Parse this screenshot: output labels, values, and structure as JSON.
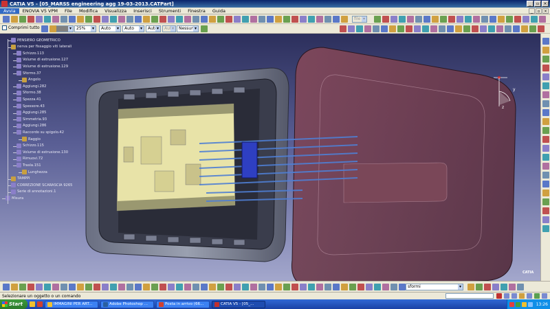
{
  "window": {
    "title": "CATIA V5 - [05_MARSS engineering agg 19-03-2013.CATPart]"
  },
  "menubar": {
    "items": [
      "Avvia",
      "ENOVIA V5 VPM",
      "File",
      "Modifica",
      "Visualizza",
      "Inserisci",
      "Strumenti",
      "Finestra",
      "Guida"
    ]
  },
  "toolbar": {
    "comprimi_label": "Comprimi tutto",
    "zoom_value": "25%",
    "combo_auto_1": "Auto",
    "combo_auto_2": "Auto",
    "combo_auto_3": "Auto",
    "combo_auto_4": "Auto",
    "combo_nessuno": "Nessuno",
    "combo_file": "file"
  },
  "spec_tree": {
    "nodes": [
      {
        "label": "PENSIERO GEOMETRICO",
        "level": 1,
        "icon_color": "#8a7fc9"
      },
      {
        "label": "nerva per fissaggio viti laterali",
        "level": 1,
        "icon_color": "#c8a040"
      },
      {
        "label": "Schizzo.113",
        "level": 2,
        "icon_color": "#8a7fc9"
      },
      {
        "label": "Volume di estrusione.127",
        "level": 2,
        "icon_color": "#8a7fc9"
      },
      {
        "label": "Volume di estrusione.129",
        "level": 2,
        "icon_color": "#8a7fc9"
      },
      {
        "label": "Sformo.37",
        "level": 2,
        "icon_color": "#8a7fc9"
      },
      {
        "label": "Angolo",
        "level": 3,
        "icon_color": "#c8a040"
      },
      {
        "label": "Aggiungi.282",
        "level": 2,
        "icon_color": "#8a7fc9"
      },
      {
        "label": "Sformo.38",
        "level": 2,
        "icon_color": "#8a7fc9"
      },
      {
        "label": "Spezza.41",
        "level": 2,
        "icon_color": "#8a7fc9"
      },
      {
        "label": "Spessore.43",
        "level": 2,
        "icon_color": "#8a7fc9"
      },
      {
        "label": "Aggiungi.285",
        "level": 2,
        "icon_color": "#8a7fc9"
      },
      {
        "label": "Simmetria.93",
        "level": 2,
        "icon_color": "#8a7fc9"
      },
      {
        "label": "Aggiungi.286",
        "level": 2,
        "icon_color": "#8a7fc9"
      },
      {
        "label": "Raccordo su spigolo.42",
        "level": 2,
        "icon_color": "#8a7fc9"
      },
      {
        "label": "Raggio",
        "level": 3,
        "icon_color": "#c8a040"
      },
      {
        "label": "Schizzo.115",
        "level": 2,
        "icon_color": "#8a7fc9"
      },
      {
        "label": "Volume di estrusione.130",
        "level": 2,
        "icon_color": "#8a7fc9"
      },
      {
        "label": "Rimuovi.72",
        "level": 2,
        "icon_color": "#8a7fc9"
      },
      {
        "label": "Trasla.151",
        "level": 2,
        "icon_color": "#8a7fc9"
      },
      {
        "label": "Lunghezza",
        "level": 3,
        "icon_color": "#c8a040"
      },
      {
        "label": "TAMPPI",
        "level": 1,
        "icon_color": "#c8a040"
      },
      {
        "label": "CORREZIONE SCARASCIA 9265",
        "level": 1,
        "icon_color": "#8a7fc9"
      },
      {
        "label": "Serie di annotazioni.1",
        "level": 1,
        "icon_color": "#8a7fc9"
      },
      {
        "label": "Misura",
        "level": 0,
        "icon_color": "#8a7fc9"
      }
    ]
  },
  "compass": {
    "axis_label": "x",
    "axis_label2": "z",
    "axis_label3": "y"
  },
  "bottom_toolbar": {
    "combo_value": "sformi"
  },
  "statusbar": {
    "text": "Selezionare un oggetto o un comando"
  },
  "taskbar": {
    "start_label": "Start",
    "tasks": [
      {
        "label": "IMMAGINI PER ART...",
        "icon_color": "#f0c030",
        "active": false
      },
      {
        "label": "Adobe Photoshop ...",
        "icon_color": "#2a5fa0",
        "active": false
      },
      {
        "label": "Posta in arrivo (66...",
        "icon_color": "#d04030",
        "active": false
      },
      {
        "label": "CATIA V5 - [05_...",
        "icon_color": "#c03030",
        "active": true
      }
    ],
    "clock": "13:26"
  },
  "logo_text": "CATIA",
  "colors": {
    "title_bar": "#0a246a",
    "viewport_top": "#2c2f5c",
    "viewport_bottom": "#a3a7cc",
    "cover": "#6b3344",
    "pcb": "#e8e3a8",
    "pipes": "#4f7fd4"
  }
}
